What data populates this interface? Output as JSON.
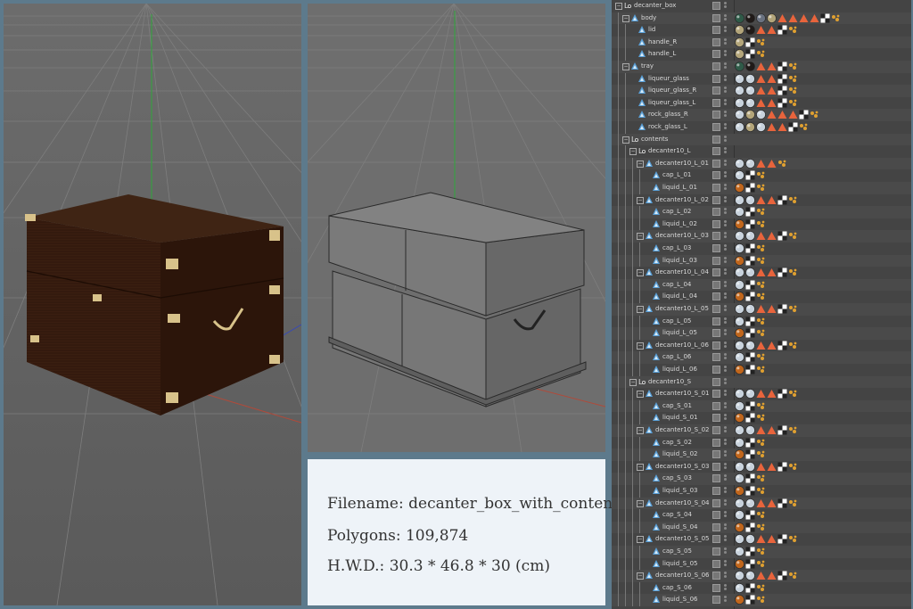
{
  "info": {
    "filename_line": "Filename: decanter_box_with_content",
    "polygons_line": "Polygons: 109,874",
    "hwd_line": "H.W.D.: 30.3 * 46.8 * 30 (cm)"
  },
  "colors": {
    "wood": "#3a1e10",
    "brass": "#d8c28a",
    "wire": "#6a6a6a",
    "viewport_bg": "#6f6f6f",
    "axis_green": "#2ea83a",
    "axis_red": "#b04a3a",
    "info_bg": "#eef3f8",
    "frame": "#5d7a8c"
  },
  "viewports": [
    {
      "name": "shaded-viewport",
      "mode": "textured"
    },
    {
      "name": "wireframe-viewport",
      "mode": "gray-shaded"
    }
  ],
  "object_manager": {
    "rows": [
      {
        "label": "decanter_box",
        "level": 0,
        "type": "null",
        "expander": "-",
        "tags": []
      },
      {
        "label": "body",
        "level": 1,
        "type": "poly",
        "expander": "-",
        "tags": [
          "mat-dkgreen",
          "mat-black",
          "mat-gray",
          "mat-tan",
          "phong",
          "phong",
          "phong",
          "phong",
          "uvw",
          "sel"
        ]
      },
      {
        "label": "lid",
        "level": 2,
        "type": "poly",
        "expander": "",
        "tags": [
          "mat-tan",
          "mat-black",
          "phong",
          "phong",
          "uvw",
          "sel"
        ]
      },
      {
        "label": "handle_R",
        "level": 2,
        "type": "poly",
        "expander": "",
        "tags": [
          "mat-tan",
          "uvw",
          "sel"
        ]
      },
      {
        "label": "handle_L",
        "level": 2,
        "type": "poly",
        "expander": "",
        "tags": [
          "mat-tan",
          "uvw",
          "sel"
        ]
      },
      {
        "label": "tray",
        "level": 1,
        "type": "poly",
        "expander": "-",
        "tags": [
          "mat-dkgreen",
          "mat-black",
          "phong",
          "phong",
          "uvw",
          "sel"
        ]
      },
      {
        "label": "liqueur_glass",
        "level": 2,
        "type": "poly",
        "expander": "",
        "tags": [
          "mat-white",
          "mat-white",
          "phong",
          "phong",
          "uvw",
          "sel"
        ]
      },
      {
        "label": "liqueur_glass_R",
        "level": 2,
        "type": "poly",
        "expander": "",
        "tags": [
          "mat-white",
          "mat-white",
          "phong",
          "phong",
          "uvw",
          "sel"
        ]
      },
      {
        "label": "liqueur_glass_L",
        "level": 2,
        "type": "poly",
        "expander": "",
        "tags": [
          "mat-white",
          "mat-white",
          "phong",
          "phong",
          "uvw",
          "sel"
        ]
      },
      {
        "label": "rock_glass_R",
        "level": 2,
        "type": "poly",
        "expander": "",
        "tags": [
          "mat-white",
          "mat-tan",
          "mat-white",
          "phong",
          "phong",
          "phong",
          "uvw",
          "sel"
        ]
      },
      {
        "label": "rock_glass_L",
        "level": 2,
        "type": "poly",
        "expander": "",
        "tags": [
          "mat-white",
          "mat-tan",
          "mat-white",
          "phong",
          "phong",
          "uvw",
          "sel"
        ]
      },
      {
        "label": "contents",
        "level": 1,
        "type": "null",
        "expander": "-",
        "tags": []
      },
      {
        "label": "decanter10_L",
        "level": 2,
        "type": "null",
        "expander": "-",
        "tags": []
      },
      {
        "label": "decanter10_L_01",
        "level": 3,
        "type": "poly",
        "expander": "-",
        "tags": [
          "mat-white",
          "mat-white",
          "phong",
          "phong",
          "sel"
        ]
      },
      {
        "label": "cap_L_01",
        "level": 4,
        "type": "poly",
        "expander": "",
        "tags": [
          "mat-white",
          "uvw",
          "sel"
        ]
      },
      {
        "label": "liquid_L_01",
        "level": 4,
        "type": "poly",
        "expander": "",
        "tags": [
          "mat-orange",
          "uvw",
          "sel"
        ]
      },
      {
        "label": "decanter10_L_02",
        "level": 3,
        "type": "poly",
        "expander": "-",
        "tags": [
          "mat-white",
          "mat-white",
          "phong",
          "phong",
          "uvw",
          "sel"
        ]
      },
      {
        "label": "cap_L_02",
        "level": 4,
        "type": "poly",
        "expander": "",
        "tags": [
          "mat-white",
          "uvw",
          "sel"
        ]
      },
      {
        "label": "liquid_L_02",
        "level": 4,
        "type": "poly",
        "expander": "",
        "tags": [
          "mat-orange",
          "uvw",
          "sel"
        ]
      },
      {
        "label": "decanter10_L_03",
        "level": 3,
        "type": "poly",
        "expander": "-",
        "tags": [
          "mat-white",
          "mat-white",
          "phong",
          "phong",
          "uvw",
          "sel"
        ]
      },
      {
        "label": "cap_L_03",
        "level": 4,
        "type": "poly",
        "expander": "",
        "tags": [
          "mat-white",
          "uvw",
          "sel"
        ]
      },
      {
        "label": "liquid_L_03",
        "level": 4,
        "type": "poly",
        "expander": "",
        "tags": [
          "mat-orange",
          "uvw",
          "sel"
        ]
      },
      {
        "label": "decanter10_L_04",
        "level": 3,
        "type": "poly",
        "expander": "-",
        "tags": [
          "mat-white",
          "mat-white",
          "phong",
          "phong",
          "uvw",
          "sel"
        ]
      },
      {
        "label": "cap_L_04",
        "level": 4,
        "type": "poly",
        "expander": "",
        "tags": [
          "mat-white",
          "uvw",
          "sel"
        ]
      },
      {
        "label": "liquid_L_04",
        "level": 4,
        "type": "poly",
        "expander": "",
        "tags": [
          "mat-orange",
          "uvw",
          "sel"
        ]
      },
      {
        "label": "decanter10_L_05",
        "level": 3,
        "type": "poly",
        "expander": "-",
        "tags": [
          "mat-white",
          "mat-white",
          "phong",
          "phong",
          "uvw",
          "sel"
        ]
      },
      {
        "label": "cap_L_05",
        "level": 4,
        "type": "poly",
        "expander": "",
        "tags": [
          "mat-white",
          "uvw",
          "sel"
        ]
      },
      {
        "label": "liquid_L_05",
        "level": 4,
        "type": "poly",
        "expander": "",
        "tags": [
          "mat-orange",
          "uvw",
          "sel"
        ]
      },
      {
        "label": "decanter10_L_06",
        "level": 3,
        "type": "poly",
        "expander": "-",
        "tags": [
          "mat-white",
          "mat-white",
          "phong",
          "phong",
          "uvw",
          "sel"
        ]
      },
      {
        "label": "cap_L_06",
        "level": 4,
        "type": "poly",
        "expander": "",
        "tags": [
          "mat-white",
          "uvw",
          "sel"
        ]
      },
      {
        "label": "liquid_L_06",
        "level": 4,
        "type": "poly",
        "expander": "",
        "tags": [
          "mat-orange",
          "uvw",
          "sel"
        ]
      },
      {
        "label": "decanter10_S",
        "level": 2,
        "type": "null",
        "expander": "-",
        "tags": []
      },
      {
        "label": "decanter10_S_01",
        "level": 3,
        "type": "poly",
        "expander": "-",
        "tags": [
          "mat-white",
          "mat-white",
          "phong",
          "phong",
          "uvw",
          "sel"
        ]
      },
      {
        "label": "cap_S_01",
        "level": 4,
        "type": "poly",
        "expander": "",
        "tags": [
          "mat-white",
          "uvw",
          "sel"
        ]
      },
      {
        "label": "liquid_S_01",
        "level": 4,
        "type": "poly",
        "expander": "",
        "tags": [
          "mat-orange",
          "uvw",
          "sel"
        ]
      },
      {
        "label": "decanter10_S_02",
        "level": 3,
        "type": "poly",
        "expander": "-",
        "tags": [
          "mat-white",
          "mat-white",
          "phong",
          "phong",
          "uvw",
          "sel"
        ]
      },
      {
        "label": "cap_S_02",
        "level": 4,
        "type": "poly",
        "expander": "",
        "tags": [
          "mat-white",
          "uvw",
          "sel"
        ]
      },
      {
        "label": "liquid_S_02",
        "level": 4,
        "type": "poly",
        "expander": "",
        "tags": [
          "mat-orange",
          "uvw",
          "sel"
        ]
      },
      {
        "label": "decanter10_S_03",
        "level": 3,
        "type": "poly",
        "expander": "-",
        "tags": [
          "mat-white",
          "mat-white",
          "phong",
          "phong",
          "uvw",
          "sel"
        ]
      },
      {
        "label": "cap_S_03",
        "level": 4,
        "type": "poly",
        "expander": "",
        "tags": [
          "mat-white",
          "uvw",
          "sel"
        ]
      },
      {
        "label": "liquid_S_03",
        "level": 4,
        "type": "poly",
        "expander": "",
        "tags": [
          "mat-orange",
          "uvw",
          "sel"
        ]
      },
      {
        "label": "decanter10_S_04",
        "level": 3,
        "type": "poly",
        "expander": "-",
        "tags": [
          "mat-white",
          "mat-white",
          "phong",
          "phong",
          "uvw",
          "sel"
        ]
      },
      {
        "label": "cap_S_04",
        "level": 4,
        "type": "poly",
        "expander": "",
        "tags": [
          "mat-white",
          "uvw",
          "sel"
        ]
      },
      {
        "label": "liquid_S_04",
        "level": 4,
        "type": "poly",
        "expander": "",
        "tags": [
          "mat-orange",
          "uvw",
          "sel"
        ]
      },
      {
        "label": "decanter10_S_05",
        "level": 3,
        "type": "poly",
        "expander": "-",
        "tags": [
          "mat-white",
          "mat-white",
          "phong",
          "phong",
          "uvw",
          "sel"
        ]
      },
      {
        "label": "cap_S_05",
        "level": 4,
        "type": "poly",
        "expander": "",
        "tags": [
          "mat-white",
          "uvw",
          "sel"
        ]
      },
      {
        "label": "liquid_S_05",
        "level": 4,
        "type": "poly",
        "expander": "",
        "tags": [
          "mat-orange",
          "uvw",
          "sel"
        ]
      },
      {
        "label": "decanter10_S_06",
        "level": 3,
        "type": "poly",
        "expander": "-",
        "tags": [
          "mat-white",
          "mat-white",
          "phong",
          "phong",
          "uvw",
          "sel"
        ]
      },
      {
        "label": "cap_S_06",
        "level": 4,
        "type": "poly",
        "expander": "",
        "tags": [
          "mat-white",
          "uvw",
          "sel"
        ]
      },
      {
        "label": "liquid_S_06",
        "level": 4,
        "type": "poly",
        "expander": "",
        "tags": [
          "mat-orange",
          "uvw",
          "sel"
        ]
      }
    ]
  }
}
